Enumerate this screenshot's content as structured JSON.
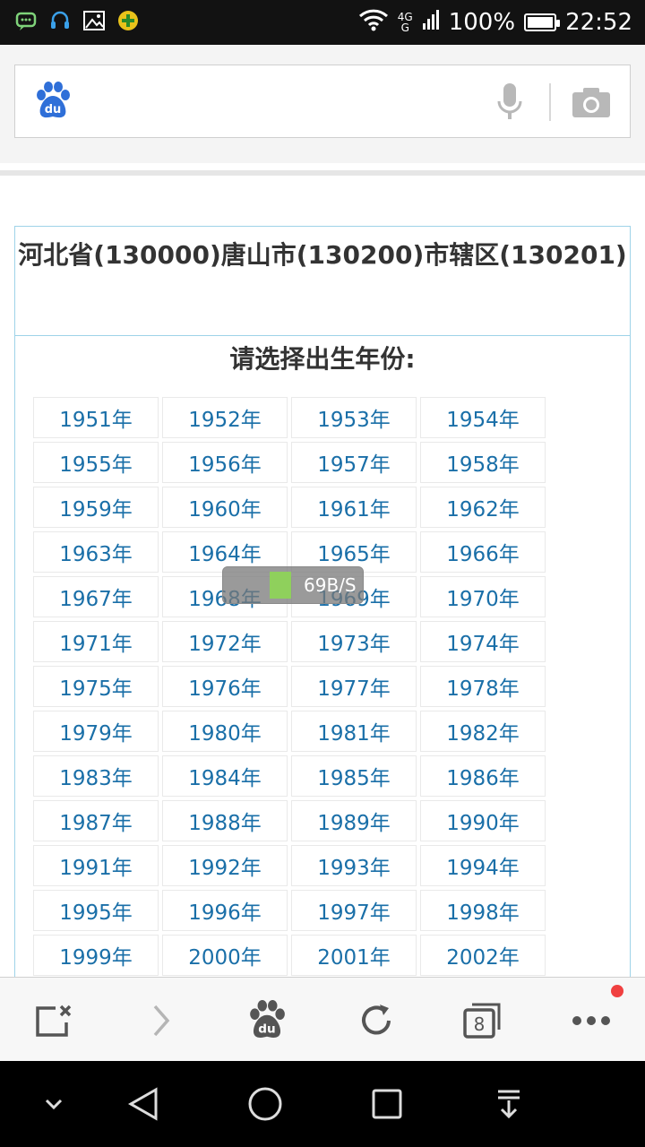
{
  "status_bar": {
    "network": "4G",
    "battery_percent": "100%",
    "battery_level": 1.0,
    "time": "22:52"
  },
  "search_bar": {
    "logo_text": "du",
    "query": ""
  },
  "page": {
    "heading": "河北省(130000)唐山市(130200)市辖区(130201)",
    "prompt": "请选择出生年份:",
    "years": [
      "1951年",
      "1952年",
      "1953年",
      "1954年",
      "1955年",
      "1956年",
      "1957年",
      "1958年",
      "1959年",
      "1960年",
      "1961年",
      "1962年",
      "1963年",
      "1964年",
      "1965年",
      "1966年",
      "1967年",
      "1968年",
      "1969年",
      "1970年",
      "1971年",
      "1972年",
      "1973年",
      "1974年",
      "1975年",
      "1976年",
      "1977年",
      "1978年",
      "1979年",
      "1980年",
      "1981年",
      "1982年",
      "1983年",
      "1984年",
      "1985年",
      "1986年",
      "1987年",
      "1988年",
      "1989年",
      "1990年",
      "1991年",
      "1992年",
      "1993年",
      "1994年",
      "1995年",
      "1996年",
      "1997年",
      "1998年",
      "1999年",
      "2000年",
      "2001年",
      "2002年"
    ]
  },
  "speed_toast": {
    "text": "69B/S"
  },
  "toolbar": {
    "tab_count": "8",
    "baidu_text": "du"
  },
  "colors": {
    "link": "#1a6fa8",
    "border": "#9ed3e8",
    "notification": "#f04040"
  }
}
